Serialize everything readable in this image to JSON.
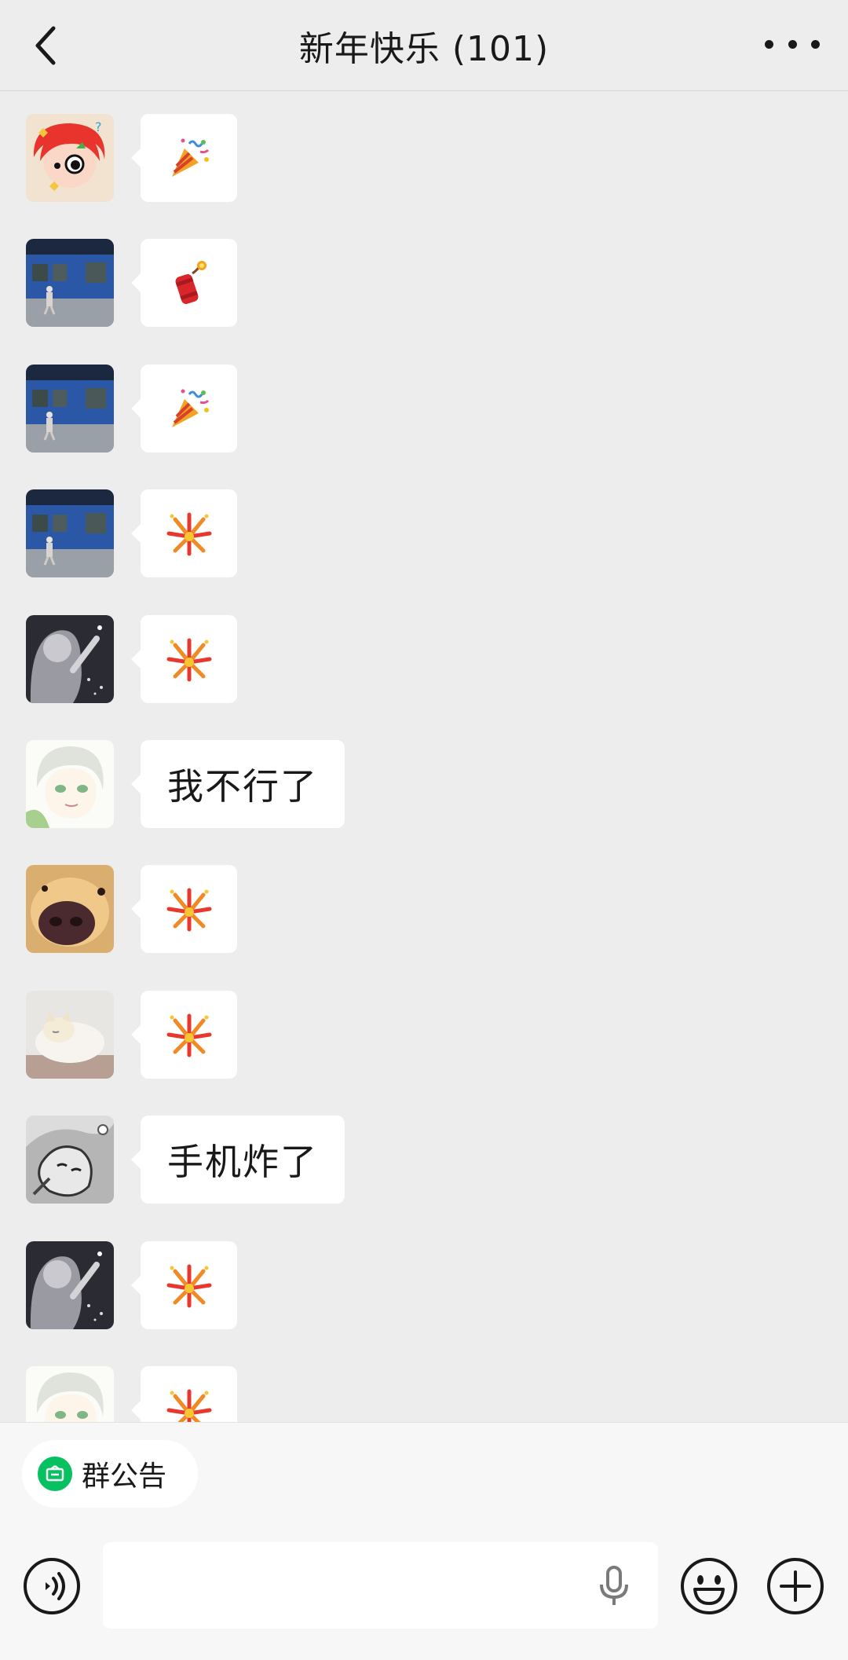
{
  "header": {
    "title": "新年快乐 (101)",
    "back_icon": "chevron-left-icon",
    "more_icon": "more-dots-icon"
  },
  "messages": [
    {
      "avatar": "avatar-redhair-cartoon",
      "type": "emoji",
      "emoji": "party-popper"
    },
    {
      "avatar": "avatar-blue-building",
      "type": "emoji",
      "emoji": "firecracker"
    },
    {
      "avatar": "avatar-blue-building",
      "type": "emoji",
      "emoji": "party-popper"
    },
    {
      "avatar": "avatar-blue-building",
      "type": "emoji",
      "emoji": "fireworks"
    },
    {
      "avatar": "avatar-night-girl",
      "type": "emoji",
      "emoji": "fireworks"
    },
    {
      "avatar": "avatar-anime-girl",
      "type": "text",
      "text": "我不行了"
    },
    {
      "avatar": "avatar-dog-nose",
      "type": "emoji",
      "emoji": "fireworks"
    },
    {
      "avatar": "avatar-cat",
      "type": "emoji",
      "emoji": "fireworks"
    },
    {
      "avatar": "avatar-sketch",
      "type": "text",
      "text": "手机炸了"
    },
    {
      "avatar": "avatar-night-girl",
      "type": "emoji",
      "emoji": "fireworks"
    },
    {
      "avatar": "avatar-anime-girl",
      "type": "emoji",
      "emoji": "fireworks"
    }
  ],
  "bottom_bar": {
    "notice_label": "群公告",
    "voice_icon": "voice-icon",
    "mic_icon": "microphone-icon",
    "emoji_icon": "smiley-icon",
    "plus_icon": "plus-circle-icon"
  },
  "colors": {
    "background": "#ededed",
    "bubble": "#ffffff",
    "accent_green": "#07c160"
  }
}
